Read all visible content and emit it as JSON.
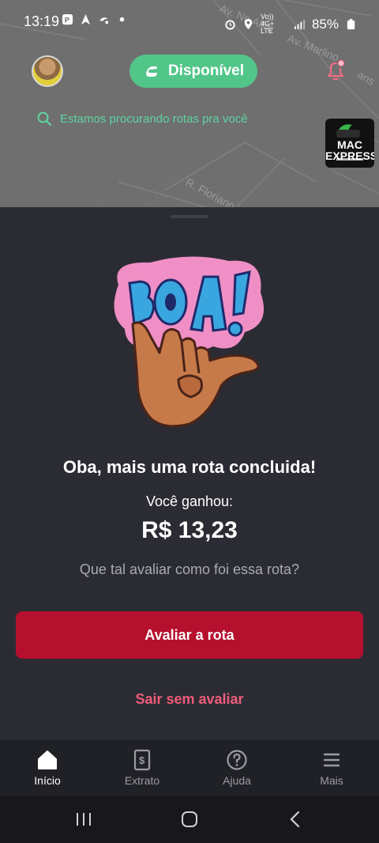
{
  "status_bar": {
    "time": "13:19",
    "battery": "85%",
    "network": "Vo)) 4G+ LTE"
  },
  "map": {
    "streets": [
      "Av. Ne Alfre",
      "Av. Marlino",
      "R. Floriano",
      "ans"
    ]
  },
  "header": {
    "availability_label": "Disponível",
    "searching_text": "Estamos procurando rotas pra você",
    "partner_logo_text": "MAC EXPRESS",
    "accent_color": "#52c689"
  },
  "sheet": {
    "illustration_text": "BOA!",
    "headline": "Oba, mais uma rota concluida!",
    "earned_label": "Você ganhou:",
    "earned_value": "R$ 13,23",
    "rate_question": "Que tal avaliar como foi essa rota?",
    "rate_button": "Avaliar a rota",
    "skip_link": "Sair sem avaliar",
    "button_color": "#b5102d"
  },
  "nav": {
    "items": [
      {
        "label": "Início",
        "icon": "home-icon",
        "active": true
      },
      {
        "label": "Extrato",
        "icon": "statement-icon",
        "active": false
      },
      {
        "label": "Ajuda",
        "icon": "help-icon",
        "active": false
      },
      {
        "label": "Mais",
        "icon": "menu-icon",
        "active": false
      }
    ]
  }
}
